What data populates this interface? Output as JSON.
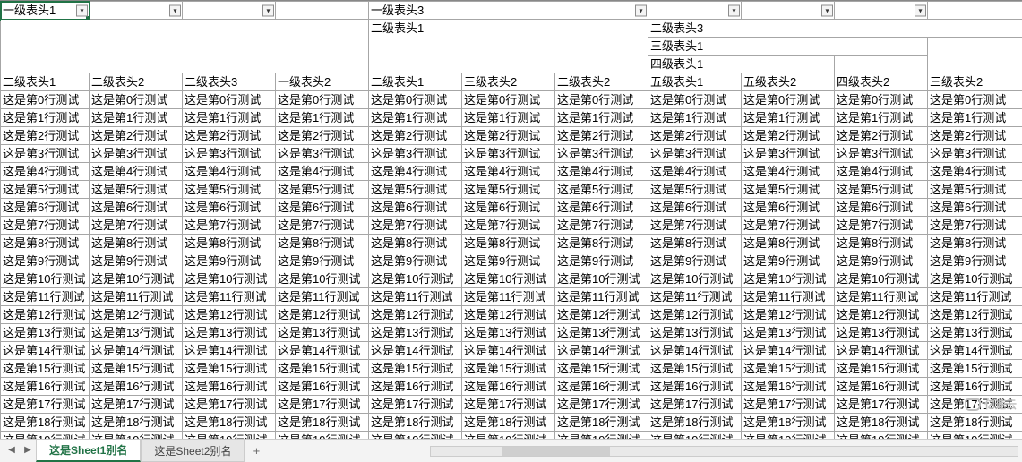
{
  "filter_row": [
    "一级表头1",
    "",
    "",
    "",
    "一级表头3",
    "",
    "",
    "",
    "",
    "",
    ""
  ],
  "header_rows": [
    {
      "cells": [
        {
          "text": "",
          "colspan": 1,
          "rowspan": 4
        },
        {
          "text": "",
          "colspan": 1,
          "rowspan": 4
        },
        {
          "text": "",
          "colspan": 1,
          "rowspan": 4
        },
        {
          "text": "",
          "colspan": 1,
          "rowspan": 4
        },
        {
          "text": "二级表头1",
          "colspan": 3,
          "rowspan": 1
        },
        {
          "text": "二级表头3",
          "colspan": 4,
          "rowspan": 1
        }
      ]
    },
    {
      "cells": [
        {
          "text": "",
          "colspan": 1,
          "rowspan": 3
        },
        {
          "text": "",
          "colspan": 1,
          "rowspan": 3
        },
        {
          "text": "",
          "colspan": 1,
          "rowspan": 3
        },
        {
          "text": "三级表头1",
          "colspan": 3,
          "rowspan": 1
        },
        {
          "text": "",
          "colspan": 1,
          "rowspan": 3
        }
      ]
    },
    {
      "cells": [
        {
          "text": "",
          "colspan": 1,
          "rowspan": 2
        },
        {
          "text": "",
          "colspan": 1,
          "rowspan": 2
        },
        {
          "text": "",
          "colspan": 1,
          "rowspan": 2
        },
        {
          "text": "四级表头1",
          "colspan": 2,
          "rowspan": 1
        },
        {
          "text": "",
          "colspan": 1,
          "rowspan": 2
        },
        {
          "text": "",
          "colspan": 1,
          "rowspan": 2
        }
      ]
    },
    {
      "cells": [
        {
          "text": "二级表头1",
          "colspan": 1
        },
        {
          "text": "二级表头2",
          "colspan": 1
        },
        {
          "text": "二级表头3",
          "colspan": 1
        },
        {
          "text": "一级表头2",
          "colspan": 1
        },
        {
          "text": "二级表头1",
          "colspan": 1
        },
        {
          "text": "三级表头2",
          "colspan": 1
        },
        {
          "text": "二级表头2",
          "colspan": 1
        },
        {
          "text": "五级表头1",
          "colspan": 1
        },
        {
          "text": "五级表头2",
          "colspan": 1
        },
        {
          "text": "四级表头2",
          "colspan": 1
        },
        {
          "text": "三级表头2",
          "colspan": 1
        }
      ]
    }
  ],
  "leaf_header_row": [
    "二级表头1",
    "二级表头2",
    "二级表头3",
    "一级表头2",
    "二级表头1",
    "三级表头2",
    "二级表头2",
    "五级表头1",
    "五级表头2",
    "四级表头2",
    "三级表头2"
  ],
  "row_prefix": "这是第",
  "row_suffix": "行测试",
  "num_rows": 21,
  "num_cols": 11,
  "tabs": [
    "这是Sheet1别名",
    "这是Sheet2别名"
  ],
  "active_tab": 0,
  "add_tab_label": "+",
  "watermark": "亿速云"
}
